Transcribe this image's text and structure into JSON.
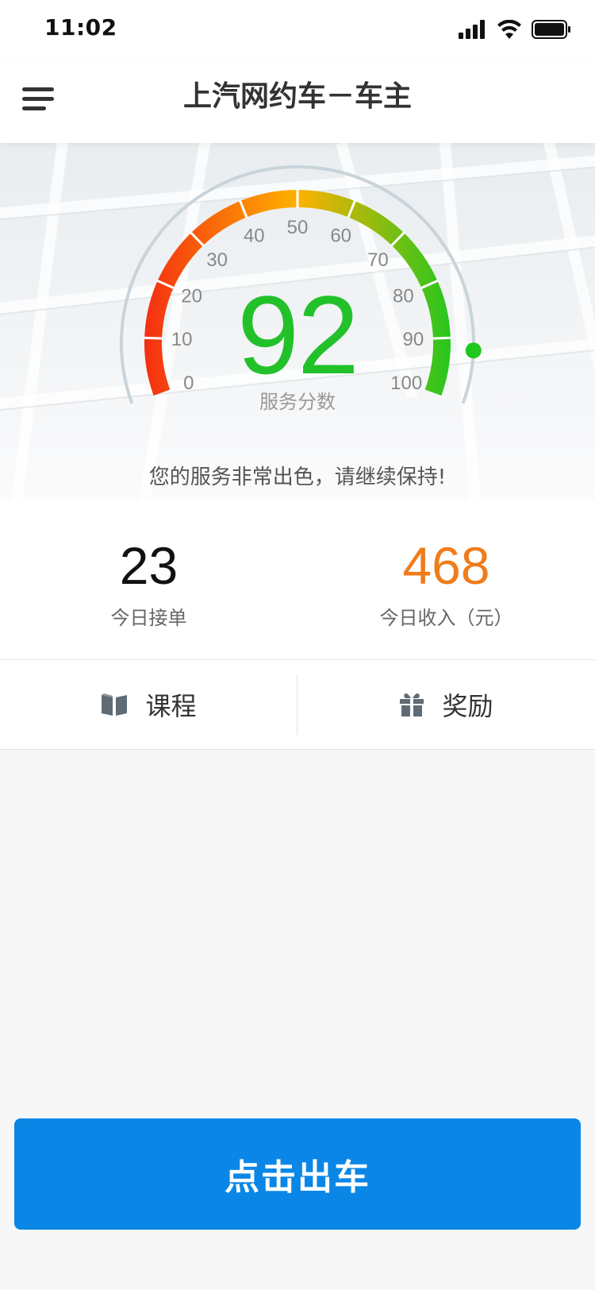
{
  "status_bar": {
    "time": "11:02",
    "signal_icon": "signal-icon",
    "wifi_icon": "wifi-icon",
    "battery_icon": "battery-icon"
  },
  "nav": {
    "title": "上汽网约车－车主",
    "menu_icon": "menu-icon"
  },
  "gauge": {
    "score": "92",
    "score_value": 92,
    "min": 0,
    "max": 100,
    "score_label": "服务分数",
    "ticks": [
      "0",
      "10",
      "20",
      "30",
      "40",
      "50",
      "60",
      "70",
      "80",
      "90",
      "100"
    ],
    "colors": {
      "low": "#f42a12",
      "mid": "#ffb100",
      "high": "#1fc71f"
    }
  },
  "message": "您的服务非常出色，请继续保持!",
  "stats": {
    "orders": {
      "value": "23",
      "label": "今日接单"
    },
    "income": {
      "value": "468",
      "label": "今日收入（元）"
    }
  },
  "actions": {
    "course": {
      "label": "课程",
      "icon": "book-icon"
    },
    "reward": {
      "label": "奖励",
      "icon": "gift-icon"
    }
  },
  "depart_button": {
    "label": "点击出车",
    "color": "#0a87e6"
  }
}
